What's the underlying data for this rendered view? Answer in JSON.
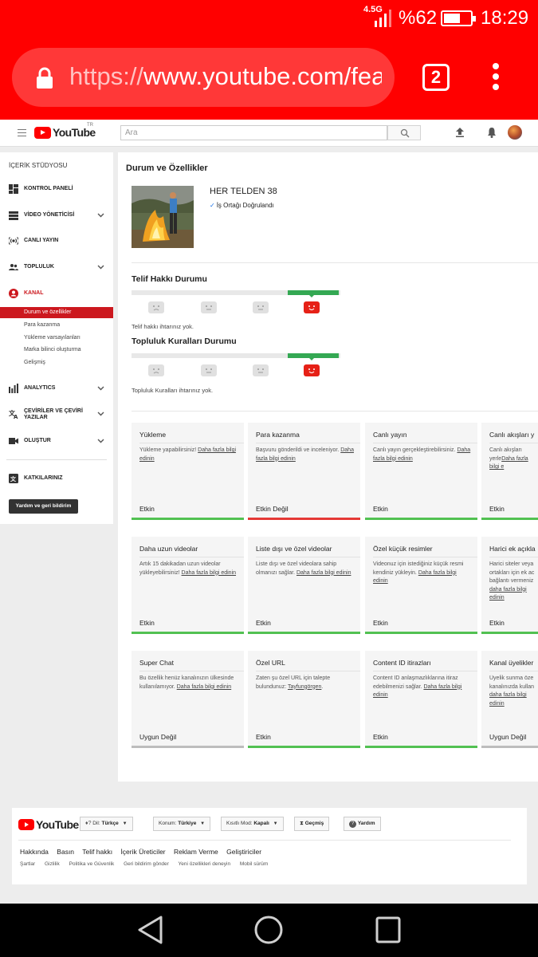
{
  "status": {
    "network": "4.5G",
    "battery_pct": "%62",
    "battery_level": 0.62,
    "time": "18:29"
  },
  "browser": {
    "url_scheme": "https://",
    "url_rest": "www.youtube.com/fea",
    "tab_count": "2"
  },
  "header": {
    "logo": "YouTube",
    "country": "TR",
    "search_placeholder": "Ara"
  },
  "sidebar": {
    "studio_title": "İÇERİK STÜDYOSU",
    "items": [
      {
        "label": "KONTROL PANELİ",
        "icon": "dashboard-icon"
      },
      {
        "label": "VİDEO YÖNETİCİSİ",
        "icon": "video-manager-icon"
      },
      {
        "label": "CANLI YAYIN",
        "icon": "live-icon"
      },
      {
        "label": "TOPLULUK",
        "icon": "community-icon"
      },
      {
        "label": "KANAL",
        "icon": "channel-icon"
      },
      {
        "label": "ANALYTICS",
        "icon": "analytics-icon"
      },
      {
        "label": "ÇEVİRİLER VE ÇEVİRİ YAZILAR",
        "icon": "translate-icon"
      },
      {
        "label": "OLUŞTUR",
        "icon": "create-icon"
      },
      {
        "label": "KATKILARINIZ",
        "icon": "contributions-icon"
      }
    ],
    "channel_subitems": [
      "Durum ve özellikler",
      "Para kazanma",
      "Yükleme varsayılanları",
      "Marka bilinci oluşturma",
      "Gelişmiş"
    ],
    "feedback_button": "Yardım ve geri bildirim"
  },
  "main": {
    "title": "Durum ve Özellikler",
    "channel_name": "HER TELDEN 38",
    "verified": "İş Ortağı Doğrulandı",
    "copyright": {
      "title": "Telif Hakkı Durumu",
      "note": "Telif hakkı ihtarınız yok."
    },
    "community": {
      "title": "Topluluk Kuralları Durumu",
      "note": "Topluluk Kuralları ihtarınız yok."
    },
    "cards": [
      {
        "title": "Yükleme",
        "desc": "Yükleme yapabilirsiniz! ",
        "link": "Daha fazla bilgi edinin",
        "status": "Etkin"
      },
      {
        "title": "Para kazanma",
        "desc": "Başvuru gönderildi ve inceleniyor. ",
        "link": "Daha fazla bilgi edinin",
        "status": "Etkin Değil"
      },
      {
        "title": "Canlı yayın",
        "desc": "Canlı yayın gerçekleştirebilirsiniz. ",
        "link": "Daha fazla bilgi edinin",
        "status": "Etkin"
      },
      {
        "title": "Canlı akışları y",
        "desc": "Canlı akışları yerle",
        "link": "Daha fazla bilgi e",
        "status": "Etkin"
      },
      {
        "title": "Daha uzun videolar",
        "desc": "Artık 15 dakikadan uzun videolar yükleyebilirsiniz! ",
        "link": "Daha fazla bilgi edinin",
        "status": "Etkin"
      },
      {
        "title": "Liste dışı ve özel videolar",
        "desc": "Liste dışı ve özel videolara sahip olmanızı sağlar. ",
        "link": "Daha fazla bilgi edinin",
        "status": "Etkin"
      },
      {
        "title": "Özel küçük resimler",
        "desc": "Videonuz için istediğiniz küçük resmi kendiniz yükleyin. ",
        "link": "Daha fazla bilgi edinin",
        "status": "Etkin"
      },
      {
        "title": "Harici ek açıkla",
        "desc": "Harici siteler veya ortakları için ek ac bağlantı vermeniz ",
        "link": "daha fazla bilgi edinin",
        "status": "Etkin"
      },
      {
        "title": "Super Chat",
        "desc": "Bu özellik henüz kanalınızın ülkesinde kullanılamıyor. ",
        "link": "Daha fazla bilgi edinin",
        "status": "Uygun Değil"
      },
      {
        "title": "Özel URL",
        "desc": "Zaten şu özel URL için talepte bulundunuz: ",
        "link": "Tayfungörgen",
        "status": "Etkin"
      },
      {
        "title": "Content ID itirazları",
        "desc": "Content ID anlaşmazlıklarına itiraz edebilmenizi sağlar. ",
        "link": "Daha fazla bilgi edinin",
        "status": "Etkin"
      },
      {
        "title": "Kanal üyelikler",
        "desc": "Üyelik sunma öze kanalınızda kullan ",
        "link": "daha fazla bilgi edinin",
        "status": "Uygun Değil"
      }
    ]
  },
  "footer": {
    "logo": "YouTube",
    "lang_label": "Dil:",
    "lang_value": "Türkçe",
    "loc_label": "Konum:",
    "loc_value": "Türkiye",
    "restricted_label": "Kısıtlı Mod:",
    "restricted_value": "Kapalı",
    "history": "Geçmiş",
    "help": "Yardım",
    "links": [
      "Hakkında",
      "Basın",
      "Telif hakkı",
      "İçerik Üreticiler",
      "Reklam Verme",
      "Geliştiriciler"
    ],
    "links2": [
      "Şartlar",
      "Gizlilik",
      "Politika ve Güvenlik",
      "Geri bildirim gönder",
      "Yeni özellikleri deneyin",
      "Mobil sürüm"
    ]
  }
}
